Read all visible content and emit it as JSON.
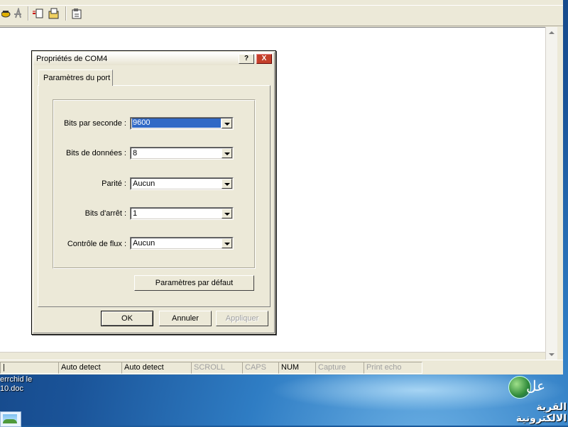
{
  "desktop": {
    "icon_text_line1": "errchid le",
    "icon_text_line2": "10.doc",
    "logo_text": "القرية الالكترونية",
    "logo_script": "عل"
  },
  "toolbar": {
    "icons": [
      "phone-icon",
      "disconnect-icon",
      "send-icon",
      "receive-icon",
      "properties-icon"
    ]
  },
  "status": {
    "cells": [
      {
        "label": "|",
        "dim": false
      },
      {
        "label": "Auto detect",
        "dim": false
      },
      {
        "label": "Auto detect",
        "dim": false
      },
      {
        "label": "SCROLL",
        "dim": true
      },
      {
        "label": "CAPS",
        "dim": true
      },
      {
        "label": "NUM",
        "dim": false
      },
      {
        "label": "Capture",
        "dim": true
      },
      {
        "label": "Print echo",
        "dim": true
      }
    ]
  },
  "dialog": {
    "title": "Propriétés de COM4",
    "help_label": "?",
    "close_label": "X",
    "tab_label": "Paramètres du port",
    "fields": {
      "bits_per_second": {
        "label": "Bits par seconde :",
        "value": "9600"
      },
      "data_bits": {
        "label": "Bits de données :",
        "value": "8"
      },
      "parity": {
        "label": "Parité :",
        "value": "Aucun"
      },
      "stop_bits": {
        "label": "Bits d'arrêt :",
        "value": "1"
      },
      "flow_control": {
        "label": "Contrôle de flux :",
        "value": "Aucun"
      }
    },
    "defaults_button": "Paramètres par défaut",
    "ok_button": "OK",
    "cancel_button": "Annuler",
    "apply_button": "Appliquer"
  }
}
